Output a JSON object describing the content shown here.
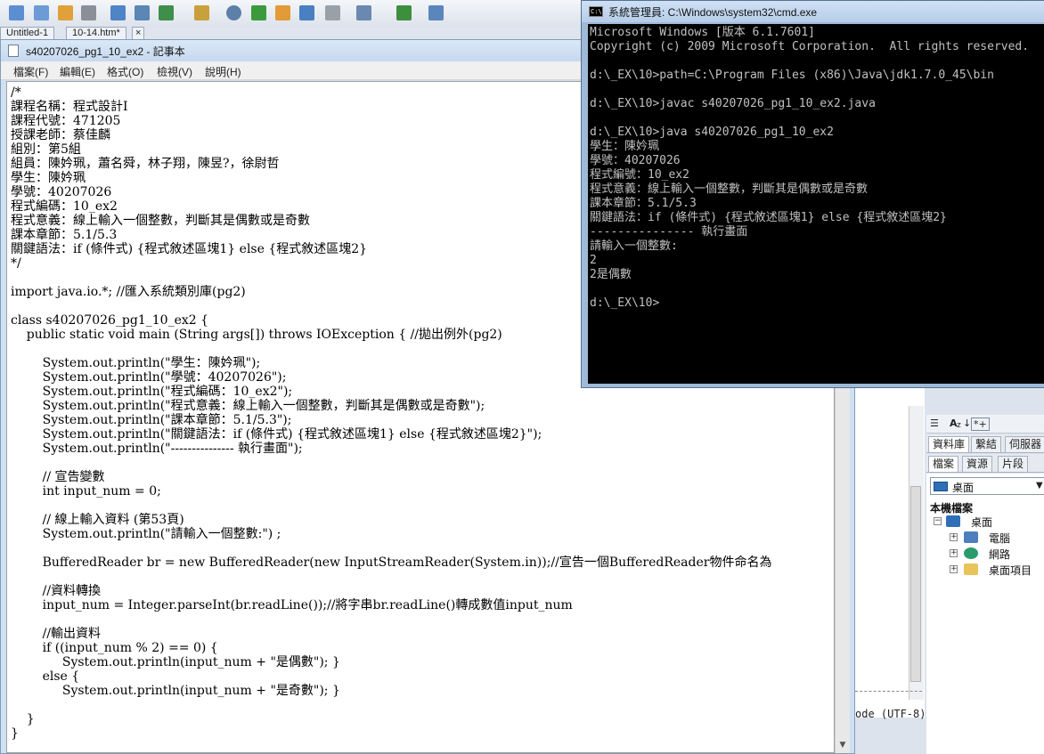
{
  "ide": {
    "tabs": [
      "Untitled-1",
      "10-14.htm*",
      "×"
    ],
    "encoding": "ode (UTF-8)",
    "prop_toolbar": [
      "A",
      "z",
      "↓",
      "*+"
    ],
    "panel_tabs_1": [
      "資料庫",
      "繫結",
      "伺服器"
    ],
    "panel_tabs_2": [
      "檔案",
      "資源",
      "片段"
    ],
    "combo_value": "桌面",
    "section_title": "本機檔案",
    "tree": {
      "root": "桌面",
      "children": [
        "電腦",
        "網路",
        "桌面項目"
      ]
    }
  },
  "notepad": {
    "title": "s40207026_pg1_10_ex2 - 記事本",
    "menu": [
      "檔案(F)",
      "編輯(E)",
      "格式(O)",
      "檢視(V)",
      "說明(H)"
    ],
    "lines": [
      "/*",
      "課程名稱：程式設計I",
      "課程代號：471205",
      "授課老師：蔡佳麟",
      "組別：第5組",
      "組員：陳妗珮，蕭名舜，林子翔，陳昱?，徐尉哲",
      "學生：陳妗珮",
      "學號：40207026",
      "程式編碼：10_ex2",
      "程式意義：線上輸入一個整數，判斷其是偶數或是奇數",
      "課本章節：5.1/5.3",
      "關鍵語法：if (條件式) {程式敘述區塊1} else {程式敘述區塊2}",
      "*/",
      "",
      "import java.io.*; //匯入系統類別庫(pg2)",
      "",
      "class s40207026_pg1_10_ex2 {",
      "    public static void main (String args[]) throws IOException { //拋出例外(pg2)",
      "",
      "        System.out.println(\"學生：陳妗珮\");",
      "        System.out.println(\"學號：40207026\");",
      "        System.out.println(\"程式編碼：10_ex2\");",
      "        System.out.println(\"程式意義：線上輸入一個整數，判斷其是偶數或是奇數\");",
      "        System.out.println(\"課本章節：5.1/5.3\");",
      "        System.out.println(\"關鍵語法：if (條件式) {程式敘述區塊1} else {程式敘述區塊2}\");",
      "        System.out.println(\"--------------- 執行畫面\");",
      "",
      "        // 宣告變數",
      "        int input_num = 0;",
      "",
      "        // 線上輸入資料 (第53頁)",
      "        System.out.println(\"請輸入一個整數:\") ;",
      "",
      "        BufferedReader br = new BufferedReader(new InputStreamReader(System.in));//宣告一個BufferedReader物件命名為",
      "",
      "        //資料轉換",
      "        input_num = Integer.parseInt(br.readLine());//將字串br.readLine()轉成數值input_num",
      "",
      "        //輸出資料",
      "        if ((input_num % 2) == 0) {",
      "             System.out.println(input_num + \"是偶數\"); }",
      "        else {",
      "             System.out.println(input_num + \"是奇數\"); }",
      "",
      "    }",
      "}"
    ]
  },
  "cmd": {
    "title": "系統管理員: C:\\Windows\\system32\\cmd.exe",
    "icon_text": "C:\\",
    "lines": [
      "Microsoft Windows [版本 6.1.7601]",
      "Copyright (c) 2009 Microsoft Corporation.  All rights reserved.",
      "",
      "d:\\_EX\\10>path=C:\\Program Files (x86)\\Java\\jdk1.7.0_45\\bin",
      "",
      "d:\\_EX\\10>javac s40207026_pg1_10_ex2.java",
      "",
      "d:\\_EX\\10>java s40207026_pg1_10_ex2",
      "學生：陳妗珮",
      "學號：40207026",
      "程式編號：10_ex2",
      "程式意義：線上輸入一個整數，判斷其是偶數或是奇數",
      "課本章節：5.1/5.3",
      "關鍵語法：if (條件式) {程式敘述區塊1} else {程式敘述區塊2}",
      "--------------- 執行畫面",
      "請輸入一個整數:",
      "2",
      "2是偶數",
      "",
      "d:\\_EX\\10>"
    ]
  },
  "colors": {
    "cmd_bg": "#000000",
    "cmd_text": "#c0c0c0",
    "notepad_bg": "#ffffff"
  }
}
